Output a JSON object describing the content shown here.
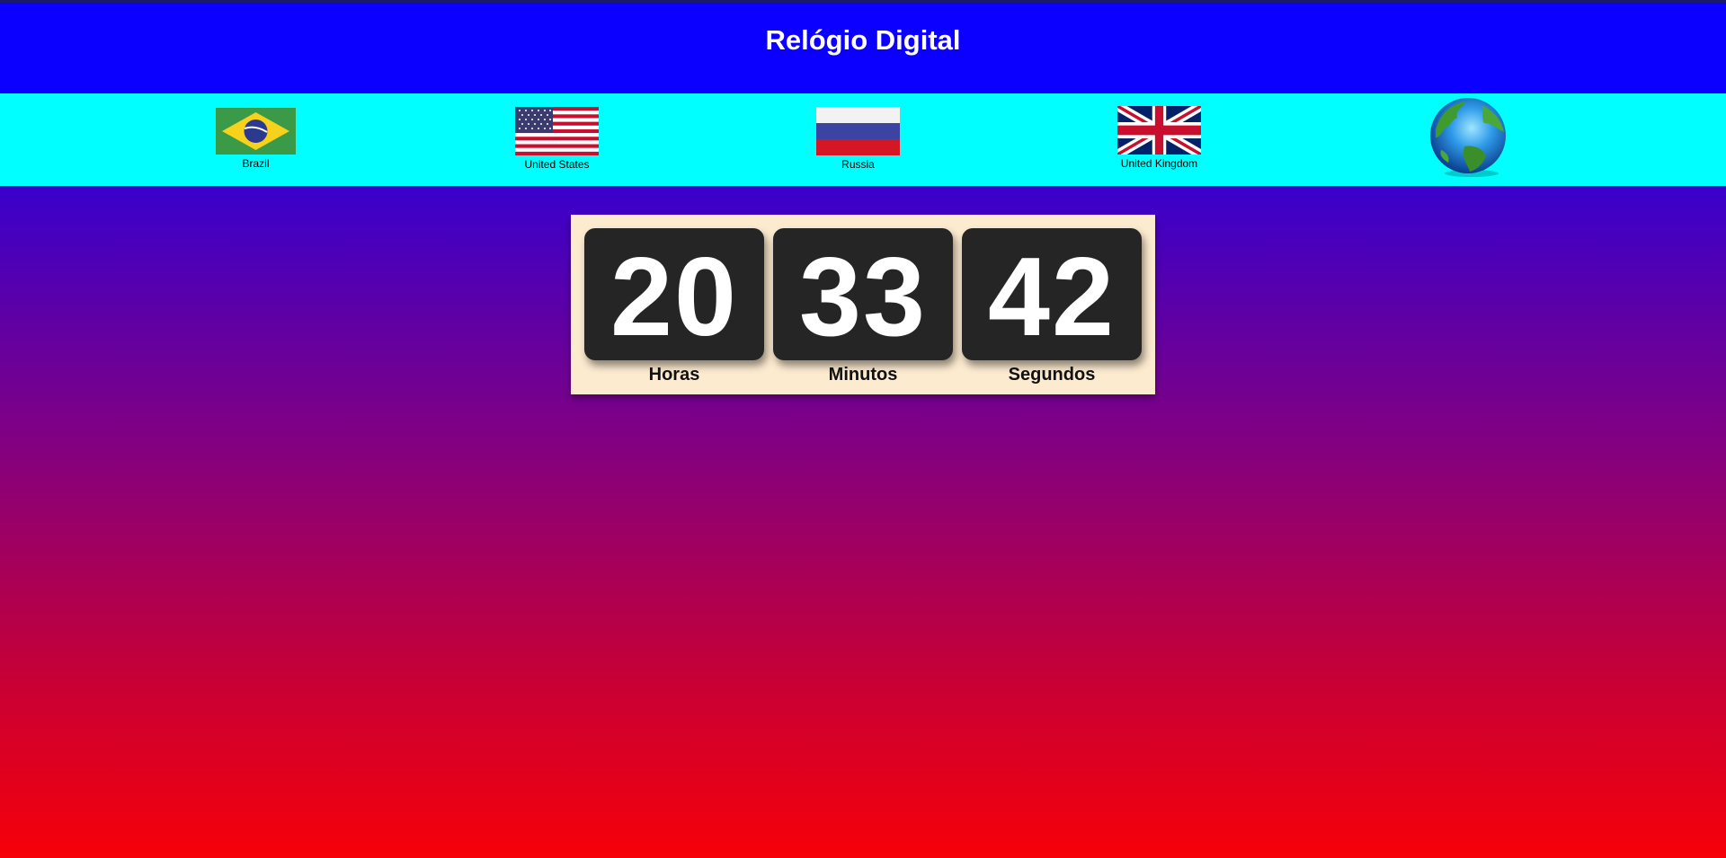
{
  "header": {
    "title": "Relógio Digital"
  },
  "flags": [
    {
      "label": "Brazil",
      "icon": "brazil-flag-icon"
    },
    {
      "label": "United States",
      "icon": "usa-flag-icon"
    },
    {
      "label": "Russia",
      "icon": "russia-flag-icon"
    },
    {
      "label": "United Kingdom",
      "icon": "uk-flag-icon"
    },
    {
      "label": "",
      "icon": "globe-icon"
    }
  ],
  "clock": {
    "hours": "20",
    "minutes": "33",
    "seconds": "42",
    "hours_label": "Horas",
    "minutes_label": "Minutos",
    "seconds_label": "Segundos"
  },
  "colors": {
    "header_bg": "#0b00ff",
    "flagbar_bg": "#00ffff",
    "panel_bg": "#fdebd0",
    "tile_bg": "#252525",
    "gradient_top": "#3f00c6",
    "gradient_bottom": "#f70008"
  }
}
